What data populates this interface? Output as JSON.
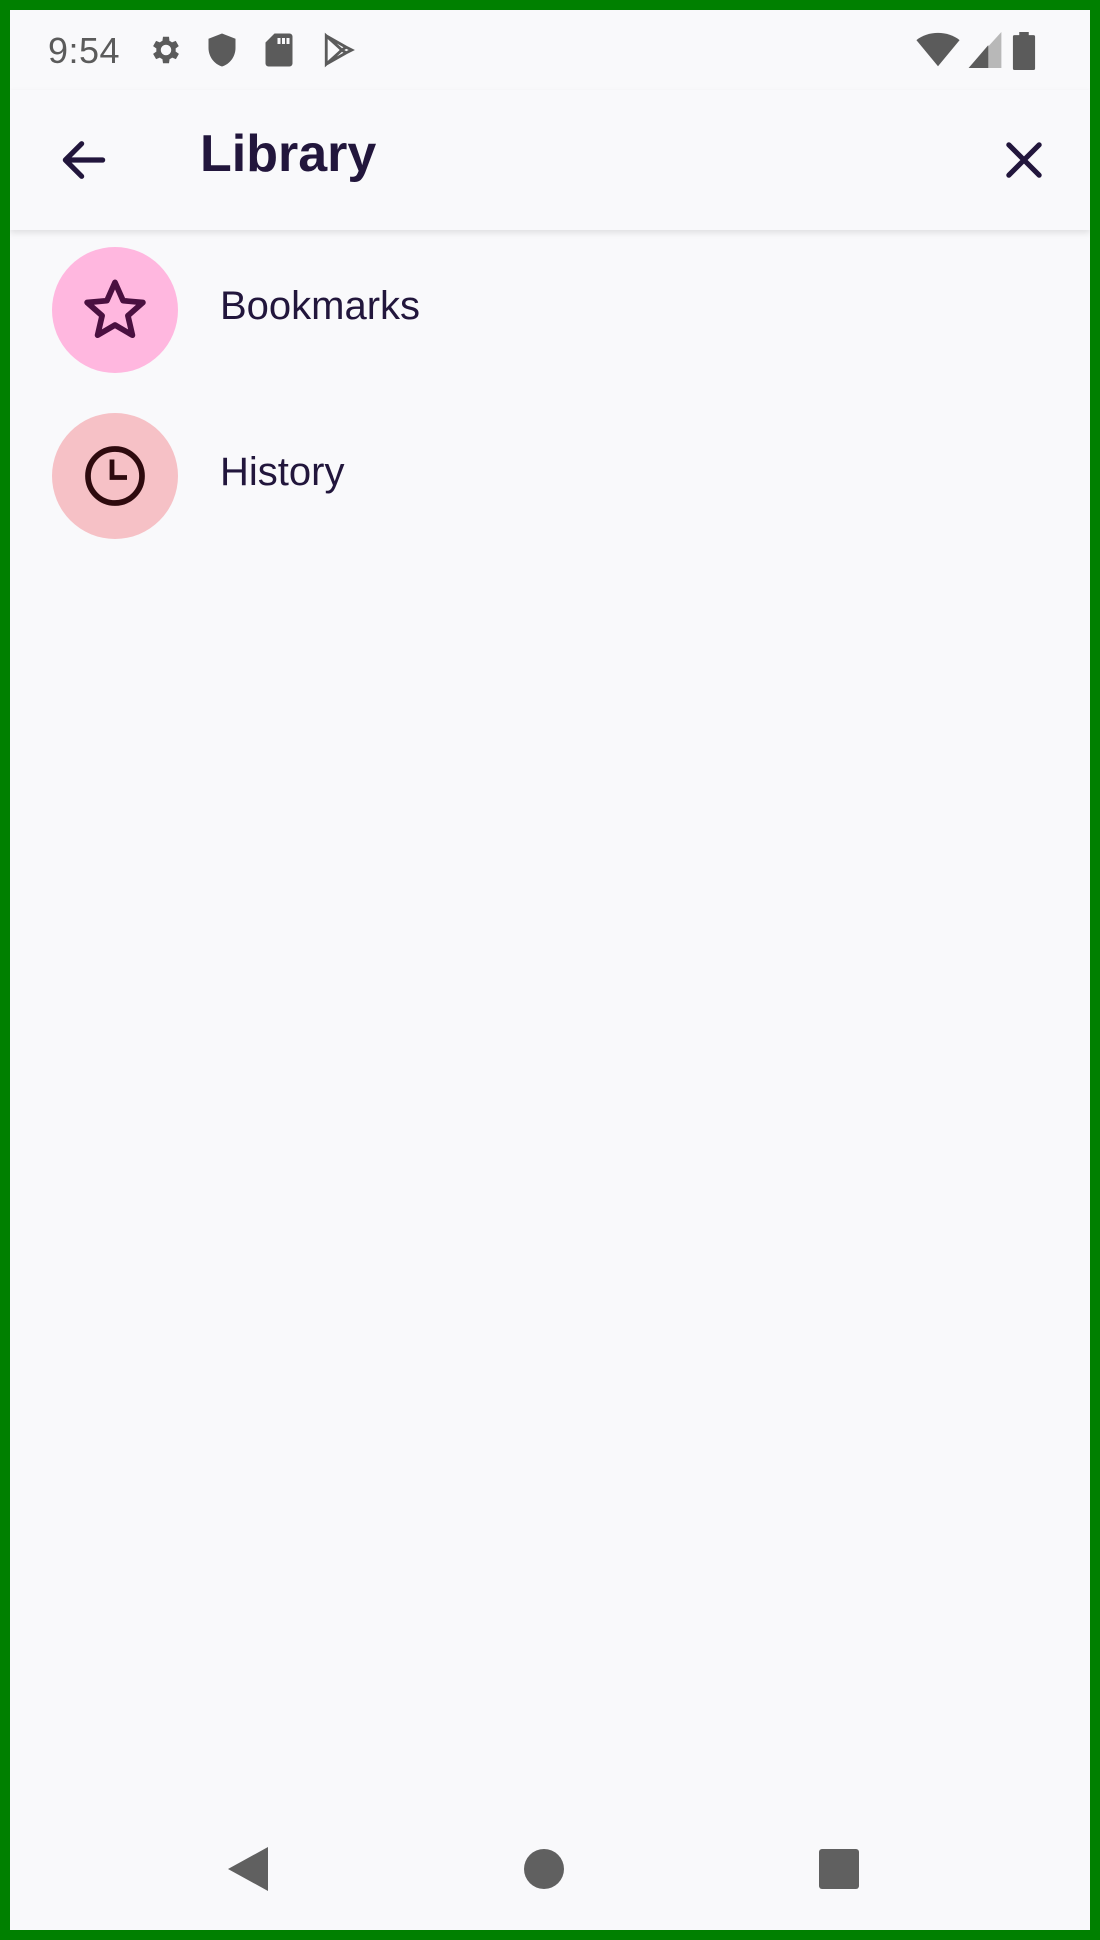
{
  "status_bar": {
    "time": "9:54",
    "left_icons": [
      "gear-icon",
      "shield-icon",
      "sd-card-icon",
      "play-store-icon"
    ],
    "right_icons": [
      "wifi-icon",
      "cell-signal-icon",
      "battery-icon"
    ]
  },
  "app_bar": {
    "title": "Library",
    "back_icon": "arrow-left-icon",
    "close_icon": "close-icon"
  },
  "library_items": [
    {
      "label": "Bookmarks",
      "icon": "star-icon",
      "icon_bg": "#ffb7df",
      "icon_color": "#4a1040"
    },
    {
      "label": "History",
      "icon": "clock-icon",
      "icon_bg": "#f6c1c6",
      "icon_color": "#2e0a0e"
    }
  ],
  "nav_bar": {
    "icons": [
      "back-triangle-icon",
      "home-circle-icon",
      "recents-square-icon"
    ]
  },
  "colors": {
    "background": "#f9f9fb",
    "text_primary": "#22163c",
    "frame": "#008000"
  }
}
